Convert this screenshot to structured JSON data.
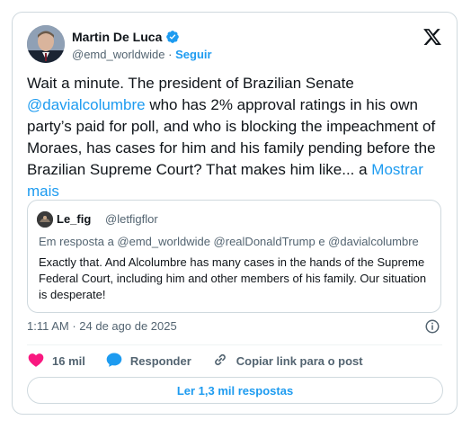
{
  "author": {
    "name": "Martin De Luca",
    "handle": "@emd_worldwide",
    "separator": "·",
    "follow_label": "Seguir"
  },
  "tweet": {
    "text_1": "Wait a minute. The president of Brazilian Senate ",
    "mention": "@davialcolumbre",
    "text_2": " who has 2% approval ratings in his own party’s paid for poll, and who is blocking the impeachment of Moraes, has cases for him and his family pending before the Brazilian Supreme Court? That makes him like... a ",
    "show_more": "Mostrar mais"
  },
  "quoted": {
    "name": "Le_fig",
    "handle": "@letfigflor",
    "reply_line": "Em resposta a @emd_worldwide @realDonaldTrump e @davialcolumbre",
    "text": "Exactly that. And Alcolumbre has many cases in the hands of the Supreme Federal Court, including him and other members of his family. Our situation is desperate!"
  },
  "timestamp": "1:11 AM · 24 de ago de 2025",
  "actions": {
    "likes": "16 mil",
    "reply_label": "Responder",
    "copy_link_label": "Copiar link para o post"
  },
  "read_replies_label": "Ler 1,3 mil respostas",
  "colors": {
    "accent": "#1d9bf0",
    "like": "#f91880",
    "text": "#0f1419",
    "muted": "#536471",
    "border": "#cfd9de"
  },
  "icons": [
    "verified-badge-icon",
    "x-logo-icon",
    "info-icon",
    "heart-icon",
    "reply-bubble-icon",
    "link-icon"
  ]
}
